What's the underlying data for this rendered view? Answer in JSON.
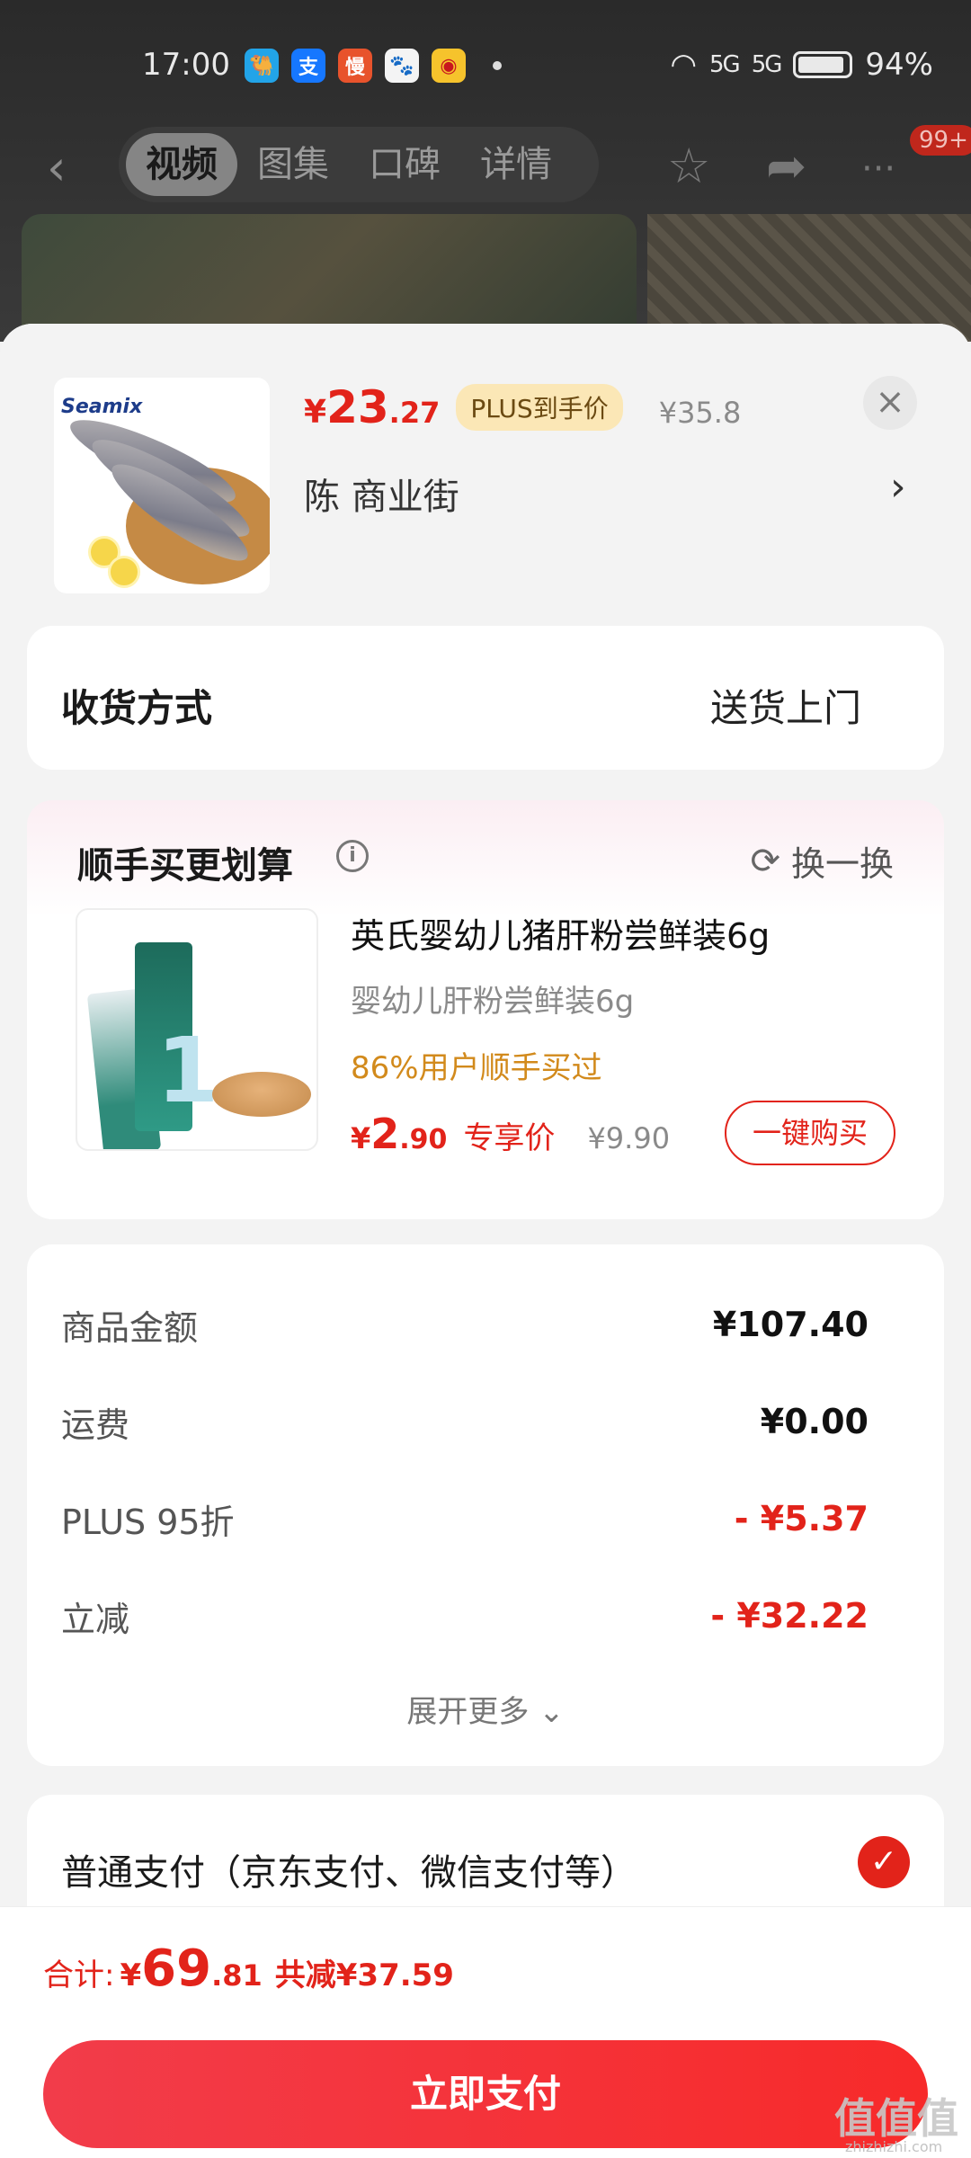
{
  "status_bar": {
    "time": "17:00",
    "battery": "94%",
    "signal": "5G"
  },
  "top_nav": {
    "tabs": [
      {
        "label": "视频",
        "active": true
      },
      {
        "label": "图集",
        "active": false
      },
      {
        "label": "口碑",
        "active": false
      },
      {
        "label": "详情",
        "active": false
      }
    ],
    "badge": "99+",
    "icons": [
      "back-icon",
      "star-icon",
      "share-icon",
      "more-icon"
    ]
  },
  "product": {
    "brand_logo_text": "Seamix",
    "price_currency": "¥",
    "price_int": "23",
    "price_dec": ".27",
    "plus_tag": "PLUS到手价",
    "original_price": "¥35.8",
    "address": "陈  商业街",
    "address_arrow": "›",
    "close_symbol": "×"
  },
  "delivery": {
    "label": "收货方式",
    "value": "送货上门"
  },
  "upsell": {
    "title": "顺手买更划算",
    "info_symbol": "i",
    "swap_label": "换一换",
    "swap_symbol": "⟳",
    "item": {
      "name": "英氏婴幼儿猪肝粉尝鲜装6g",
      "subtitle": "婴幼儿肝粉尝鲜装6g",
      "social_proof": "86%用户顺手买过",
      "price_currency": "¥",
      "price_int": "2",
      "price_dec": ".90",
      "price_tag": "专享价",
      "original_price": "¥9.90",
      "buy_label": "一键购买",
      "package_number": "1"
    }
  },
  "summary": {
    "rows": [
      {
        "label": "商品金额",
        "value": "¥107.40",
        "highlight": false
      },
      {
        "label": "运费",
        "value": "¥0.00",
        "highlight": false
      },
      {
        "label": "PLUS 95折",
        "value": "- ¥5.37",
        "highlight": true
      },
      {
        "label": "立减",
        "value": "- ¥32.22",
        "highlight": true
      }
    ],
    "expand_label": "展开更多 ⌄"
  },
  "payment": {
    "method_label": "普通支付（京东支付、微信支付等）",
    "selected": true,
    "check_symbol": "✓"
  },
  "footer": {
    "total_label": "合计:",
    "total_currency": "¥",
    "total_int": "69",
    "total_dec": ".81",
    "total_saved": "共减¥37.59",
    "pay_button": "立即支付"
  },
  "watermark": {
    "text": "值值值",
    "sub": "zhizhizhi.com"
  },
  "colors": {
    "accent": "#e2231a",
    "plus_tag_bg": "#fbe7b6",
    "social_proof": "#d28a1c"
  }
}
